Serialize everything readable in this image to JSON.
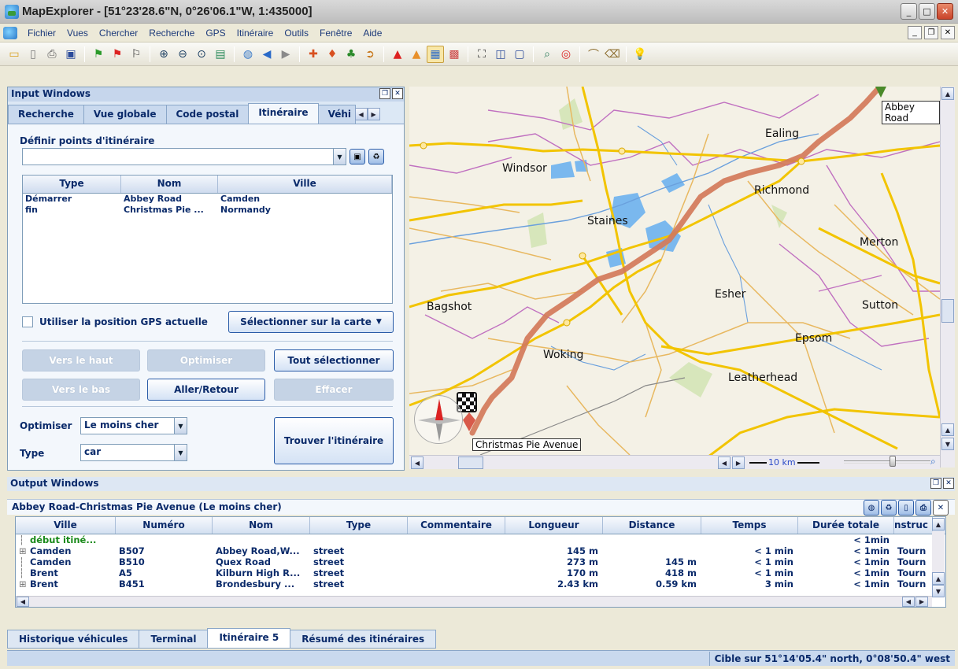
{
  "window": {
    "title": "MapExplorer - [51°23'28.6\"N, 0°26'06.1\"W, 1:435000]"
  },
  "menu": [
    "Fichier",
    "Vues",
    "Chercher",
    "Recherche",
    "GPS",
    "Itinéraire",
    "Outils",
    "Fenêtre",
    "Aide"
  ],
  "input_panel": {
    "title": "Input Windows",
    "tabs": [
      "Recherche",
      "Vue globale",
      "Code postal",
      "Itinéraire",
      "Véhi"
    ],
    "active_tab": "Itinéraire",
    "section_label": "Définir points d'itinéraire",
    "route_input_value": "",
    "list_headers": [
      "Type",
      "Nom",
      "Ville"
    ],
    "list_rows": [
      {
        "type": "Démarrer",
        "nom": "Abbey Road",
        "ville": "Camden"
      },
      {
        "type": "fin",
        "nom": "Christmas Pie ...",
        "ville": "Normandy"
      }
    ],
    "gps_checkbox_label": "Utiliser la position GPS actuelle",
    "select_on_map": "Sélectionner sur la carte",
    "buttons": {
      "up": "Vers le haut",
      "optimize": "Optimiser",
      "select_all": "Tout sélectionner",
      "down": "Vers le bas",
      "round_trip": "Aller/Retour",
      "delete": "Effacer"
    },
    "optimize_label": "Optimiser",
    "optimize_value": "Le moins cher",
    "type_label": "Type",
    "type_value": "car",
    "find_route": "Trouver l'itinéraire"
  },
  "map": {
    "places": [
      "Ealing",
      "Windsor",
      "Richmond",
      "Staines",
      "Merton",
      "Bagshot",
      "Esher",
      "Sutton",
      "Epsom",
      "Woking",
      "Leatherhead"
    ],
    "start_marker": "Abbey Road",
    "end_marker": "Christmas Pie Avenue",
    "scale": "10 km",
    "colors": {
      "route": "#d27a5a",
      "major_road": "#f2c400",
      "minor_road": "#e8b860",
      "water": "#7ab8ee",
      "boundary": "#c070c0",
      "river": "#6aa0dd"
    }
  },
  "output_panel": {
    "title": "Output Windows",
    "subtitle": "Abbey Road-Christmas Pie Avenue (Le moins cher)",
    "columns": [
      "Ville",
      "Numéro",
      "Nom",
      "Type",
      "Commentaire",
      "Longueur",
      "Distance",
      "Temps",
      "Durée totale",
      "nstruc"
    ],
    "rows": [
      {
        "ville": "début itiné...",
        "numero": "",
        "nom": "",
        "type": "",
        "commentaire": "",
        "longueur": "",
        "distance": "",
        "temps": "",
        "duree": "< 1min",
        "instr": ""
      },
      {
        "ville": "Camden",
        "numero": "B507",
        "nom": "Abbey Road,W...",
        "type": "street",
        "commentaire": "",
        "longueur": "145 m",
        "distance": "",
        "temps": "< 1 min",
        "duree": "< 1min",
        "instr": "Tourn"
      },
      {
        "ville": "Camden",
        "numero": "B510",
        "nom": "Quex Road",
        "type": "street",
        "commentaire": "",
        "longueur": "273 m",
        "distance": "145 m",
        "temps": "< 1 min",
        "duree": "< 1min",
        "instr": "Tourn"
      },
      {
        "ville": "Brent",
        "numero": "A5",
        "nom": "Kilburn High R...",
        "type": "street",
        "commentaire": "",
        "longueur": "170 m",
        "distance": "418 m",
        "temps": "< 1 min",
        "duree": "< 1min",
        "instr": "Tourn"
      },
      {
        "ville": "Brent",
        "numero": "B451",
        "nom": "Brondesbury ...",
        "type": "street",
        "commentaire": "",
        "longueur": "2.43 km",
        "distance": "0.59 km",
        "temps": "3 min",
        "duree": "< 1min",
        "instr": "Tourn"
      }
    ]
  },
  "bottom_tabs": [
    "Historique véhicules",
    "Terminal",
    "Itinéraire 5",
    "Résumé des itinéraires"
  ],
  "active_bottom_tab": "Itinéraire 5",
  "status": "Cible sur 51°14'05.4\" north, 0°08'50.4\" west"
}
